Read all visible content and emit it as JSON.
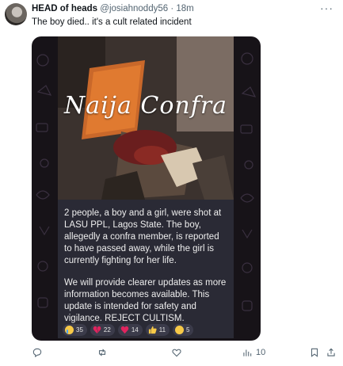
{
  "tweet": {
    "author_name": "HEAD of heads",
    "author_handle": "@josiahnoddy56",
    "separator": "·",
    "time": "18m",
    "text": "The boy died.. it's a cult related incident"
  },
  "media": {
    "watermark": "Naija Confra",
    "message_paragraph_1": "2 people, a boy and a girl, were shot at LASU PPL, Lagos State. The boy, allegedly a confra member, is reported to have passed away, while the girl is currently fighting for her life.",
    "message_paragraph_2": "We will provide clearer updates as more information becomes available. This update is intended for safety and vigilance. REJECT CULTISM.",
    "reactions": [
      {
        "icon": "crying-face-icon",
        "count": "35"
      },
      {
        "icon": "broken-heart-icon",
        "count": "22"
      },
      {
        "icon": "heart-icon",
        "count": "14"
      },
      {
        "icon": "thumbs-up-icon",
        "count": "11"
      },
      {
        "icon": "sad-face-icon",
        "count": "5"
      }
    ]
  },
  "actions": {
    "views_count": "10"
  },
  "colors": {
    "text_primary": "#0f1419",
    "text_secondary": "#536471",
    "media_bg": "#171318",
    "bubble_bg": "#2a2a35"
  }
}
